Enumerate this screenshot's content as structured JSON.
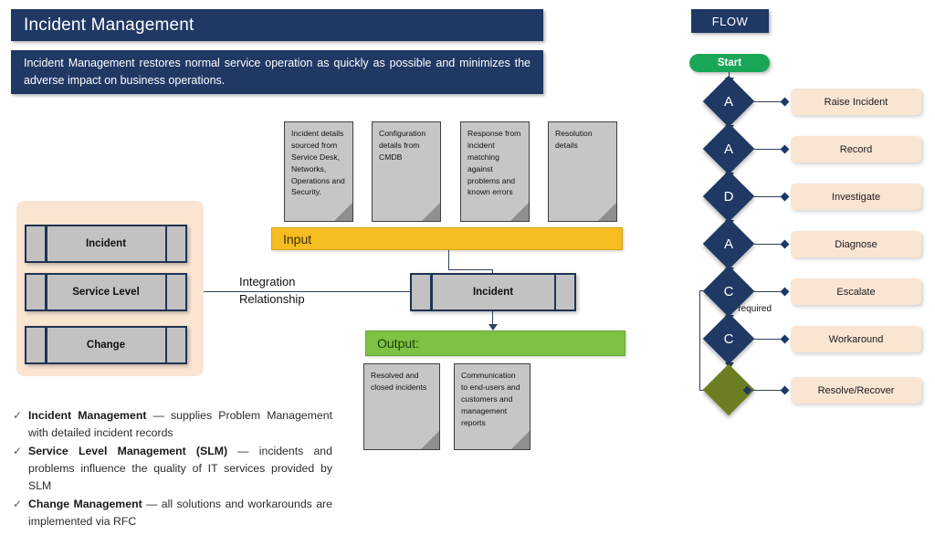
{
  "header": {
    "title": "Incident Management",
    "description": "Incident Management restores normal service operation as quickly as possible and minimizes the adverse impact on business operations."
  },
  "colors": {
    "dark_navy": "#1f3864",
    "input_bar": "#f5bd1f",
    "output_bar": "#7dc242",
    "panel_peach": "#fae5d3",
    "doc_gray": "#c6c6c6",
    "start_green": "#1aa657",
    "final_olive": "#6b7f22"
  },
  "input_documents": [
    {
      "text": "Incident details sourced from Service Desk, Networks, Operations and Security."
    },
    {
      "text": "Configuration details from CMDB"
    },
    {
      "text": "Response from incident matching against problems and known errors"
    },
    {
      "text": "Resolution details"
    }
  ],
  "input_bar": {
    "label": "Input"
  },
  "process": {
    "label": "Incident"
  },
  "output_bar": {
    "label": "Output:"
  },
  "output_documents": [
    {
      "text": "Resolved and closed incidents"
    },
    {
      "text": "Communication to end-users and customers and management reports"
    }
  ],
  "relationship": {
    "label": "Integration Relationship"
  },
  "related_processes": [
    {
      "label": "Incident"
    },
    {
      "label": "Service Level"
    },
    {
      "label": "Change"
    }
  ],
  "bullets": [
    {
      "marker": "✓",
      "bold": "Incident Management",
      "rest": " — supplies Problem Management with detailed incident records"
    },
    {
      "marker": "✓",
      "bold": "Service Level Management (SLM)",
      "rest": " — incidents and problems influence the quality of IT services provided by SLM"
    },
    {
      "marker": "✓",
      "bold": "Change Management",
      "rest": " — all solutions and workarounds are implemented via RFC"
    }
  ],
  "flow": {
    "title": "FLOW",
    "start": "Start",
    "condition_label": "If required",
    "steps": [
      {
        "code": "A",
        "label": "Raise Incident",
        "color": "#1f3864"
      },
      {
        "code": "A",
        "label": "Record",
        "color": "#1f3864"
      },
      {
        "code": "D",
        "label": "Investigate",
        "color": "#1f3864"
      },
      {
        "code": "A",
        "label": "Diagnose",
        "color": "#1f3864"
      },
      {
        "code": "C",
        "label": "Escalate",
        "color": "#1f3864"
      },
      {
        "code": "C",
        "label": "Workaround",
        "color": "#1f3864"
      },
      {
        "code": "",
        "label": "Resolve/Recover",
        "color": "#6b7f22"
      }
    ]
  }
}
